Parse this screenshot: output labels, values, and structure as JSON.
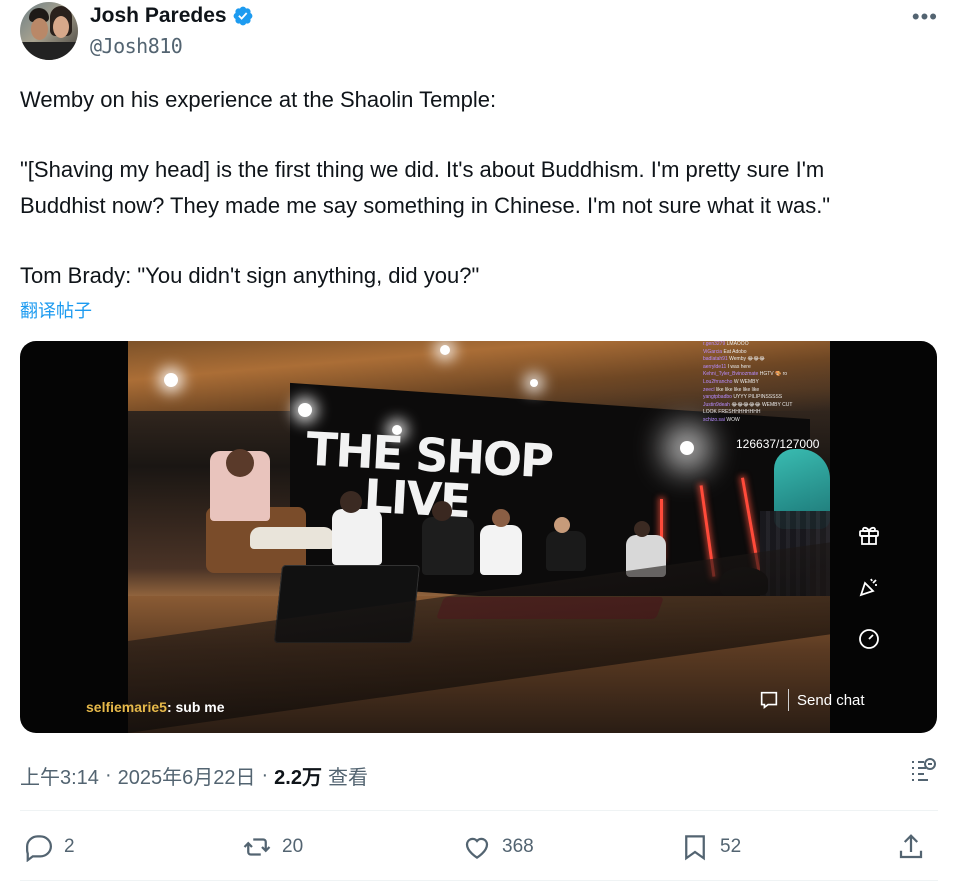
{
  "author": {
    "name": "Josh Paredes",
    "handle": "@Josh810",
    "verified_color": "#1d9bf0"
  },
  "tweet": {
    "lines": [
      "Wemby on his experience at the Shaolin Temple:",
      "\"[Shaving my head] is the first thing we did. It's about Buddhism. I'm pretty sure I'm",
      "Buddhist now? They made me say something in Chinese. I'm not sure what it was.\"",
      "Tom Brady: \"You didn't sign anything, did you?\""
    ],
    "translate_label": "翻译帖子"
  },
  "video": {
    "stage_logo_line1": "THE SHOP",
    "stage_logo_line2": "LIVE",
    "viewer_count": "126637/127000",
    "chat_feed": [
      {
        "user": "r.gen3279",
        "msg": "LMAOOO"
      },
      {
        "user": "ViGarcia",
        "msg": "Eat Adobo"
      },
      {
        "user": "badlatah91",
        "msg": "Wemby 😂😂😂"
      },
      {
        "user": "aerrylde11",
        "msg": "I was here"
      },
      {
        "user": "Kehni_Tyler_Bvinozmate",
        "msg": "HGTV 🎨 ro"
      },
      {
        "user": "Lou2frrancho",
        "msg": "W WEMBY"
      },
      {
        "user": "zeecl",
        "msg": "like like like like like"
      },
      {
        "user": "yangtpbadbo",
        "msg": "UYYY PILIPINSSSSS"
      },
      {
        "user": "Justin9deah",
        "msg": "😂😂😂😂😂 WEMBY CUT"
      },
      {
        "user": "",
        "msg": "LOOK FRESHHHHHHHH"
      },
      {
        "user": "schizo.sai",
        "msg": "WOW"
      }
    ],
    "chat_highlight_user": "selfiemarie5",
    "chat_highlight_msg": "sub me",
    "send_chat_label": "Send chat",
    "side_icons": [
      "gift-icon",
      "party-popper-icon",
      "timer-icon"
    ]
  },
  "meta": {
    "time": "上午3:14",
    "sep1": "·",
    "date": "2025年6月22日",
    "sep2": "·",
    "views_count": "2.2万",
    "views_label": "查看"
  },
  "actions": {
    "reply_count": "2",
    "repost_count": "20",
    "like_count": "368",
    "bookmark_count": "52"
  },
  "colors": {
    "text_primary": "#0f1419",
    "text_secondary": "#536471",
    "link": "#1d9bf0"
  }
}
